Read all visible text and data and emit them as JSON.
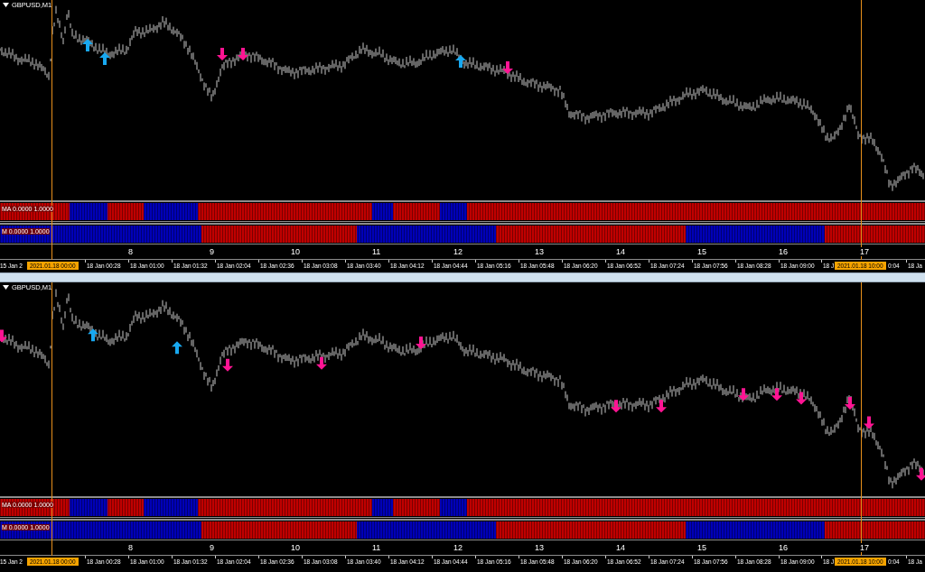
{
  "charts": [
    {
      "title": "GBPUSD,M1",
      "indicators": [
        {
          "label": "MA 0.0000 1.0000"
        },
        {
          "label": "M 0.0000 1.0000"
        }
      ],
      "scale_labels": [
        "8",
        "9",
        "10",
        "11",
        "12",
        "13",
        "14",
        "15",
        "16",
        "17"
      ],
      "time_labels": [
        {
          "text": "15 Jan 2",
          "kind": "tick"
        },
        {
          "text": "2021.01.18 00:00",
          "kind": "cursor"
        },
        {
          "text": "18 Jan 00:28",
          "kind": "tick"
        },
        {
          "text": "18 Jan 01:00",
          "kind": "tick"
        },
        {
          "text": "18 Jan 01:32",
          "kind": "tick"
        },
        {
          "text": "18 Jan 02:04",
          "kind": "tick"
        },
        {
          "text": "18 Jan 02:36",
          "kind": "tick"
        },
        {
          "text": "18 Jan 03:08",
          "kind": "tick"
        },
        {
          "text": "18 Jan 03:40",
          "kind": "tick"
        },
        {
          "text": "18 Jan 04:12",
          "kind": "tick"
        },
        {
          "text": "18 Jan 04:44",
          "kind": "tick"
        },
        {
          "text": "18 Jan 05:16",
          "kind": "tick"
        },
        {
          "text": "18 Jan 05:48",
          "kind": "tick"
        },
        {
          "text": "18 Jan 06:20",
          "kind": "tick"
        },
        {
          "text": "18 Jan 06:52",
          "kind": "tick"
        },
        {
          "text": "18 Jan 07:24",
          "kind": "tick"
        },
        {
          "text": "18 Jan 07:56",
          "kind": "tick"
        },
        {
          "text": "18 Jan 08:28",
          "kind": "tick"
        },
        {
          "text": "18 Jan 09:00",
          "kind": "tick"
        },
        {
          "text": "18 J",
          "kind": "tick"
        },
        {
          "text": "2021.01.18 10:00",
          "kind": "cursor"
        },
        {
          "text": "0:04",
          "kind": "plain"
        },
        {
          "text": "18 Ja",
          "kind": "tick"
        }
      ]
    },
    {
      "title": "GBPUSD,M1",
      "indicators": [
        {
          "label": "MA 0.0000 1.0000"
        },
        {
          "label": "M 0.0000 1.0000"
        }
      ],
      "scale_labels": [
        "8",
        "9",
        "10",
        "11",
        "12",
        "13",
        "14",
        "15",
        "16",
        "17"
      ],
      "time_labels": [
        {
          "text": "15 Jan 2",
          "kind": "tick"
        },
        {
          "text": "2021.01.18 00:00",
          "kind": "cursor"
        },
        {
          "text": "18 Jan 00:28",
          "kind": "tick"
        },
        {
          "text": "18 Jan 01:00",
          "kind": "tick"
        },
        {
          "text": "18 Jan 01:32",
          "kind": "tick"
        },
        {
          "text": "18 Jan 02:04",
          "kind": "tick"
        },
        {
          "text": "18 Jan 02:36",
          "kind": "tick"
        },
        {
          "text": "18 Jan 03:08",
          "kind": "tick"
        },
        {
          "text": "18 Jan 03:40",
          "kind": "tick"
        },
        {
          "text": "18 Jan 04:12",
          "kind": "tick"
        },
        {
          "text": "18 Jan 04:44",
          "kind": "tick"
        },
        {
          "text": "18 Jan 05:16",
          "kind": "tick"
        },
        {
          "text": "18 Jan 05:48",
          "kind": "tick"
        },
        {
          "text": "18 Jan 06:20",
          "kind": "tick"
        },
        {
          "text": "18 Jan 06:52",
          "kind": "tick"
        },
        {
          "text": "18 Jan 07:24",
          "kind": "tick"
        },
        {
          "text": "18 Jan 07:56",
          "kind": "tick"
        },
        {
          "text": "18 Jan 08:28",
          "kind": "tick"
        },
        {
          "text": "18 Jan 09:00",
          "kind": "tick"
        },
        {
          "text": "18 J",
          "kind": "tick"
        },
        {
          "text": "2021.01.18 10:00",
          "kind": "cursor"
        },
        {
          "text": "0:04",
          "kind": "plain"
        },
        {
          "text": "18 Ja",
          "kind": "tick"
        }
      ]
    }
  ]
}
